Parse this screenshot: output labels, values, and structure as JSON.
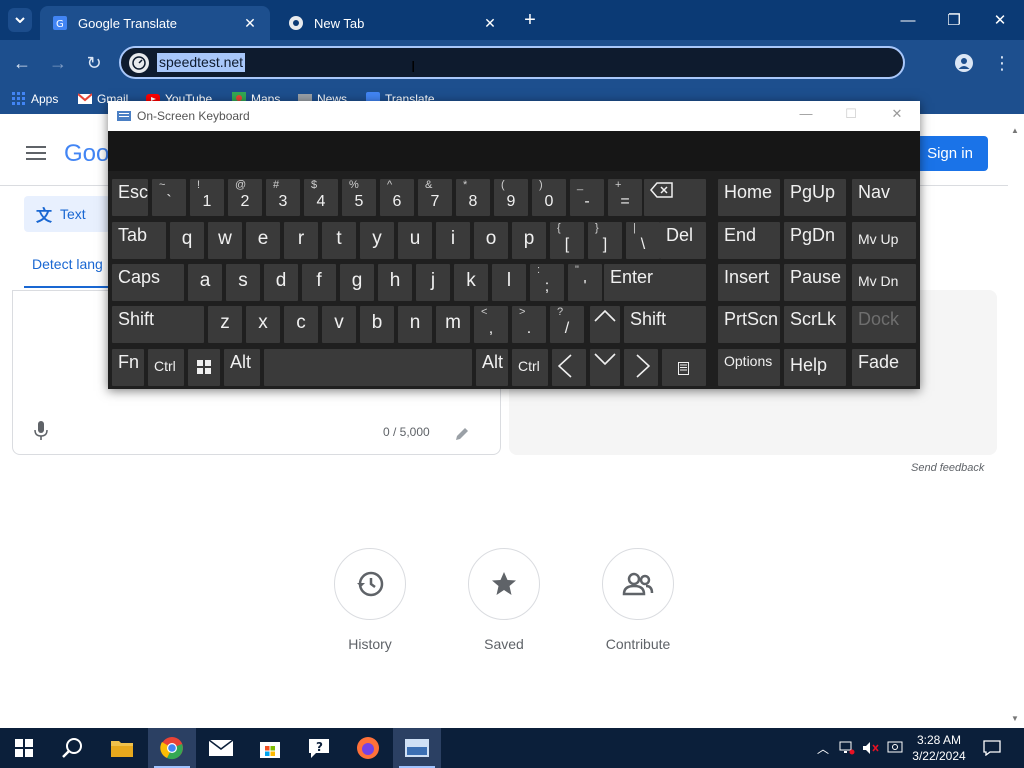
{
  "browser": {
    "tabs": [
      {
        "title": "Google Translate",
        "active": true
      },
      {
        "title": "New Tab",
        "active": false
      }
    ],
    "url": "speedtest.net",
    "bookmarks": [
      "Apps",
      "Gmail",
      "YouTube",
      "Maps",
      "News",
      "Translate"
    ]
  },
  "translate": {
    "logo_text": "Goo",
    "sign_in": "Sign in",
    "text_tab": "Text",
    "detect_tab": "Detect lang",
    "char_count": "0 / 5,000",
    "send_feedback": "Send feedback",
    "features": [
      {
        "label": "History",
        "icon": "history-icon"
      },
      {
        "label": "Saved",
        "icon": "star-icon"
      },
      {
        "label": "Contribute",
        "icon": "people-icon"
      }
    ]
  },
  "osk": {
    "title": "On-Screen Keyboard",
    "keys": {
      "esc": "Esc",
      "tab": "Tab",
      "caps": "Caps",
      "shift": "Shift",
      "fn": "Fn",
      "ctrl": "Ctrl",
      "alt": "Alt",
      "del": "Del",
      "enter": "Enter",
      "home": "Home",
      "pgup": "PgUp",
      "nav": "Nav",
      "end": "End",
      "pgdn": "PgDn",
      "mvup": "Mv Up",
      "insert": "Insert",
      "pause": "Pause",
      "mvdn": "Mv Dn",
      "prtscn": "PrtScn",
      "scrlk": "ScrLk",
      "dock": "Dock",
      "options": "Options",
      "help": "Help",
      "fade": "Fade",
      "backspace": "⌫",
      "left": "<",
      "right": ">",
      "up": "^",
      "down": "v",
      "menu": "▤"
    },
    "number_row": [
      {
        "shift": "~",
        "char": "`"
      },
      {
        "shift": "!",
        "char": "1"
      },
      {
        "shift": "@",
        "char": "2"
      },
      {
        "shift": "#",
        "char": "3"
      },
      {
        "shift": "$",
        "char": "4"
      },
      {
        "shift": "%",
        "char": "5"
      },
      {
        "shift": "^",
        "char": "6"
      },
      {
        "shift": "&",
        "char": "7"
      },
      {
        "shift": "*",
        "char": "8"
      },
      {
        "shift": "(",
        "char": "9"
      },
      {
        "shift": ")",
        "char": "0"
      },
      {
        "shift": "_",
        "char": "-"
      },
      {
        "shift": "+",
        "char": "="
      }
    ],
    "row_q": [
      "q",
      "w",
      "e",
      "r",
      "t",
      "y",
      "u",
      "i",
      "o",
      "p"
    ],
    "row_q_sym": [
      {
        "shift": "{",
        "char": "["
      },
      {
        "shift": "}",
        "char": "]"
      },
      {
        "shift": "|",
        "char": "\\"
      }
    ],
    "row_a": [
      "a",
      "s",
      "d",
      "f",
      "g",
      "h",
      "j",
      "k",
      "l"
    ],
    "row_a_sym": [
      {
        "shift": ":",
        "char": ";"
      },
      {
        "shift": "\"",
        "char": "'"
      }
    ],
    "row_z": [
      "z",
      "x",
      "c",
      "v",
      "b",
      "n",
      "m"
    ],
    "row_z_sym": [
      {
        "shift": "<",
        "char": ","
      },
      {
        "shift": ">",
        "char": "."
      },
      {
        "shift": "?",
        "char": "/"
      }
    ]
  },
  "taskbar": {
    "items": [
      "start-icon",
      "search-icon",
      "file-explorer-icon",
      "chrome-icon",
      "mail-icon",
      "store-icon",
      "help-icon",
      "firefox-icon",
      "on-screen-keyboard-icon"
    ],
    "time": "3:28 AM",
    "date": "3/22/2024"
  }
}
